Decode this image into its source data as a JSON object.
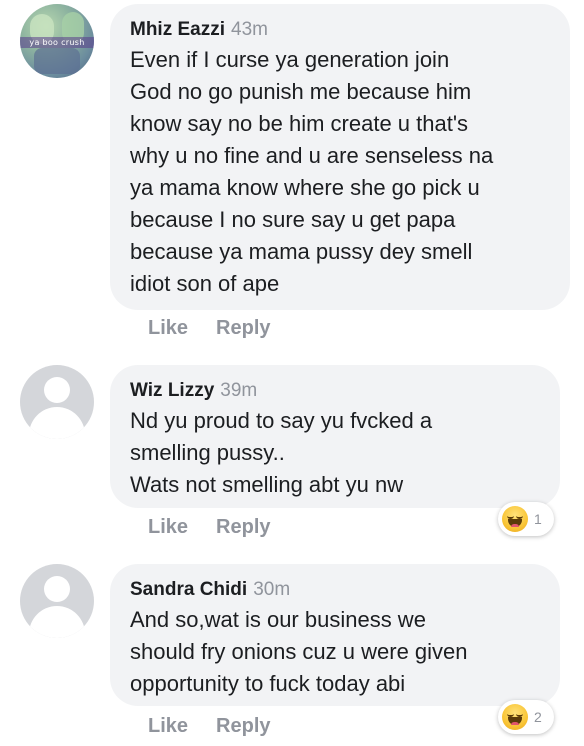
{
  "comments": [
    {
      "author": "Mhiz Eazzi",
      "time": "43m",
      "avatar_caption": "ya boo crush",
      "text": "Even if I curse ya generation join\nGod no go punish me because him\nknow say no be him create u that's\nwhy u no fine and u are senseless na\nya mama know where she go pick u\nbecause I no sure say u get papa\nbecause ya mama pussy dey smell\nidiot son of ape",
      "like": "Like",
      "reply": "Reply"
    },
    {
      "author": "Wiz Lizzy",
      "time": "39m",
      "text": "Nd yu proud to say yu fvcked a\nsmelling pussy..\nWats not smelling abt yu nw",
      "like": "Like",
      "reply": "Reply",
      "reaction": {
        "icon": "haha-icon",
        "count": "1"
      }
    },
    {
      "author": "Sandra Chidi",
      "time": "30m",
      "text": "And so,wat is our business we\nshould fry onions cuz u were given\nopportunity  to fuck today abi",
      "like": "Like",
      "reply": "Reply",
      "reaction": {
        "icon": "haha-icon",
        "count": "2"
      }
    }
  ]
}
